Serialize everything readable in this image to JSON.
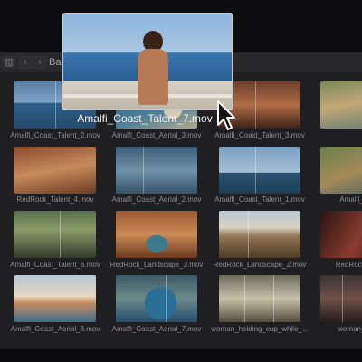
{
  "toolbar": {
    "breadcrumb": "Bal",
    "icons": [
      "sidebar-toggle-icon",
      "chevron-left-icon",
      "chevron-right-icon"
    ]
  },
  "preview": {
    "filename": "Amalfi_Coast_Talent_7.mov"
  },
  "clips": [
    {
      "name": "Amalfi_Coast_Talent_2.mov"
    },
    {
      "name": "Amalfi_Coast_Aerial_3.mov"
    },
    {
      "name": "Amalfi_Coast_Talent_3.mov"
    },
    {
      "name": ""
    },
    {
      "name": "RedRock_Talent_4.mov"
    },
    {
      "name": "Amalfi_Coast_Aerial_2.mov"
    },
    {
      "name": "Amalfi_Coast_Talent_1.mov"
    },
    {
      "name": "Amalfi_Coast"
    },
    {
      "name": "Amalfi_Coast_Talent_6.mov"
    },
    {
      "name": "RedRock_Landscape_3.mov"
    },
    {
      "name": "RedRock_Landscape_2.mov"
    },
    {
      "name": "RedRock_Talen"
    },
    {
      "name": "Amalfi_Coast_Aerial_8.mov"
    },
    {
      "name": "Amalfi_Coast_Aerial_7.mov"
    },
    {
      "name": "woman_holding_cup_while_..."
    },
    {
      "name": "woman_leanin"
    }
  ]
}
